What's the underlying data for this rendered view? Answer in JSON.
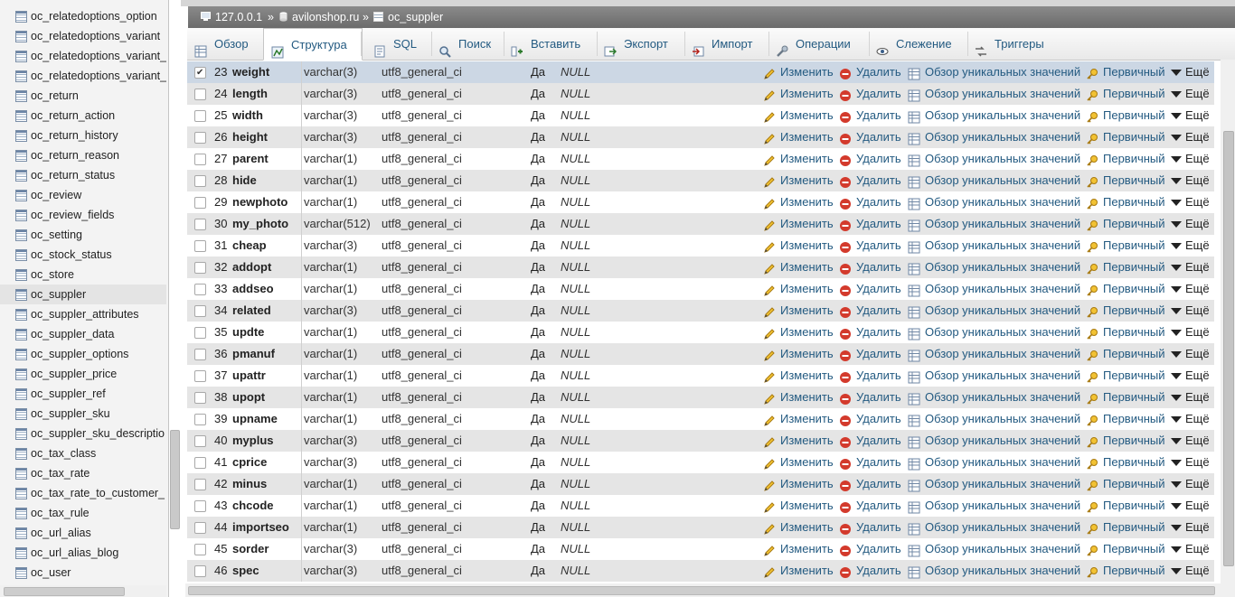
{
  "breadcrumb": {
    "server": "127.0.0.1",
    "sep1": "»",
    "database": "avilonshop.ru",
    "sep2": "»",
    "table": "oc_suppler"
  },
  "tabs": [
    {
      "label": "Обзор",
      "icon": "browse-icon"
    },
    {
      "label": "Структура",
      "icon": "structure-icon"
    },
    {
      "label": "SQL",
      "icon": "sql-icon"
    },
    {
      "label": "Поиск",
      "icon": "search-icon"
    },
    {
      "label": "Вставить",
      "icon": "insert-icon"
    },
    {
      "label": "Экспорт",
      "icon": "export-icon"
    },
    {
      "label": "Импорт",
      "icon": "import-icon"
    },
    {
      "label": "Операции",
      "icon": "wrench-icon"
    },
    {
      "label": "Слежение",
      "icon": "eye-icon"
    },
    {
      "label": "Триггеры",
      "icon": "triggers-icon"
    }
  ],
  "active_tab": "Структура",
  "sidebar": {
    "items": [
      "oc_relatedoptions_option",
      "oc_relatedoptions_variant",
      "oc_relatedoptions_variant_",
      "oc_relatedoptions_variant_",
      "oc_return",
      "oc_return_action",
      "oc_return_history",
      "oc_return_reason",
      "oc_return_status",
      "oc_review",
      "oc_review_fields",
      "oc_setting",
      "oc_stock_status",
      "oc_store",
      "oc_suppler",
      "oc_suppler_attributes",
      "oc_suppler_data",
      "oc_suppler_options",
      "oc_suppler_price",
      "oc_suppler_ref",
      "oc_suppler_sku",
      "oc_suppler_sku_descriptio",
      "oc_tax_class",
      "oc_tax_rate",
      "oc_tax_rate_to_customer_",
      "oc_tax_rule",
      "oc_url_alias",
      "oc_url_alias_blog",
      "oc_user"
    ],
    "selected": "oc_suppler"
  },
  "actions": {
    "edit": "Изменить",
    "delete": "Удалить",
    "unique": "Обзор уникальных значений",
    "primary": "Первичный",
    "more": "Ещё"
  },
  "columns": [
    {
      "num": "23",
      "name": "weight",
      "type": "varchar(3)",
      "collation": "utf8_general_ci",
      "null": "Да",
      "default": "NULL",
      "checked": true
    },
    {
      "num": "24",
      "name": "length",
      "type": "varchar(3)",
      "collation": "utf8_general_ci",
      "null": "Да",
      "default": "NULL"
    },
    {
      "num": "25",
      "name": "width",
      "type": "varchar(3)",
      "collation": "utf8_general_ci",
      "null": "Да",
      "default": "NULL"
    },
    {
      "num": "26",
      "name": "height",
      "type": "varchar(3)",
      "collation": "utf8_general_ci",
      "null": "Да",
      "default": "NULL"
    },
    {
      "num": "27",
      "name": "parent",
      "type": "varchar(1)",
      "collation": "utf8_general_ci",
      "null": "Да",
      "default": "NULL"
    },
    {
      "num": "28",
      "name": "hide",
      "type": "varchar(1)",
      "collation": "utf8_general_ci",
      "null": "Да",
      "default": "NULL"
    },
    {
      "num": "29",
      "name": "newphoto",
      "type": "varchar(1)",
      "collation": "utf8_general_ci",
      "null": "Да",
      "default": "NULL"
    },
    {
      "num": "30",
      "name": "my_photo",
      "type": "varchar(512)",
      "collation": "utf8_general_ci",
      "null": "Да",
      "default": "NULL"
    },
    {
      "num": "31",
      "name": "cheap",
      "type": "varchar(3)",
      "collation": "utf8_general_ci",
      "null": "Да",
      "default": "NULL"
    },
    {
      "num": "32",
      "name": "addopt",
      "type": "varchar(1)",
      "collation": "utf8_general_ci",
      "null": "Да",
      "default": "NULL"
    },
    {
      "num": "33",
      "name": "addseo",
      "type": "varchar(1)",
      "collation": "utf8_general_ci",
      "null": "Да",
      "default": "NULL"
    },
    {
      "num": "34",
      "name": "related",
      "type": "varchar(3)",
      "collation": "utf8_general_ci",
      "null": "Да",
      "default": "NULL"
    },
    {
      "num": "35",
      "name": "updte",
      "type": "varchar(1)",
      "collation": "utf8_general_ci",
      "null": "Да",
      "default": "NULL"
    },
    {
      "num": "36",
      "name": "pmanuf",
      "type": "varchar(1)",
      "collation": "utf8_general_ci",
      "null": "Да",
      "default": "NULL"
    },
    {
      "num": "37",
      "name": "upattr",
      "type": "varchar(1)",
      "collation": "utf8_general_ci",
      "null": "Да",
      "default": "NULL"
    },
    {
      "num": "38",
      "name": "upopt",
      "type": "varchar(1)",
      "collation": "utf8_general_ci",
      "null": "Да",
      "default": "NULL"
    },
    {
      "num": "39",
      "name": "upname",
      "type": "varchar(1)",
      "collation": "utf8_general_ci",
      "null": "Да",
      "default": "NULL"
    },
    {
      "num": "40",
      "name": "myplus",
      "type": "varchar(3)",
      "collation": "utf8_general_ci",
      "null": "Да",
      "default": "NULL"
    },
    {
      "num": "41",
      "name": "cprice",
      "type": "varchar(3)",
      "collation": "utf8_general_ci",
      "null": "Да",
      "default": "NULL"
    },
    {
      "num": "42",
      "name": "minus",
      "type": "varchar(1)",
      "collation": "utf8_general_ci",
      "null": "Да",
      "default": "NULL"
    },
    {
      "num": "43",
      "name": "chcode",
      "type": "varchar(1)",
      "collation": "utf8_general_ci",
      "null": "Да",
      "default": "NULL"
    },
    {
      "num": "44",
      "name": "importseo",
      "type": "varchar(1)",
      "collation": "utf8_general_ci",
      "null": "Да",
      "default": "NULL"
    },
    {
      "num": "45",
      "name": "sorder",
      "type": "varchar(3)",
      "collation": "utf8_general_ci",
      "null": "Да",
      "default": "NULL"
    },
    {
      "num": "46",
      "name": "spec",
      "type": "varchar(3)",
      "collation": "utf8_general_ci",
      "null": "Да",
      "default": "NULL"
    }
  ],
  "colors": {
    "link": "#235a81",
    "row_even": "#e5e5e5",
    "row_highlight": "#ccd7e4",
    "breadcrumb_bg": "#6b6b6b",
    "delete_red": "#d33a2c",
    "edit_yellow": "#e8b21c"
  }
}
